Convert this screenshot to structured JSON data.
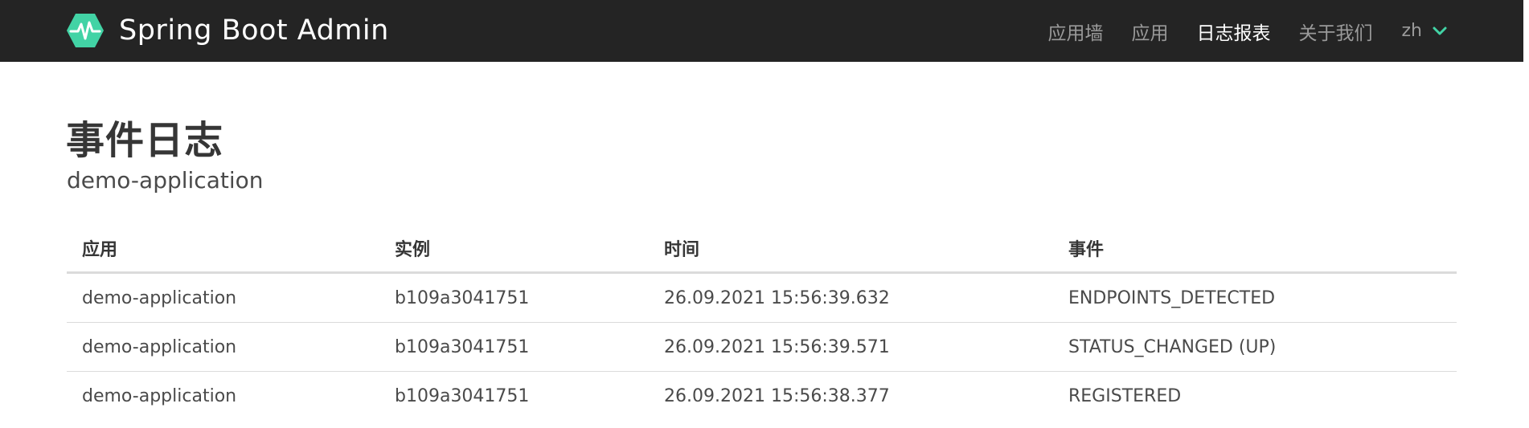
{
  "navbar": {
    "brand": {
      "logo_icon": "heartbeat-hexagon-icon",
      "title": "Spring Boot Admin"
    },
    "menu": [
      {
        "label": "应用墙",
        "active": false
      },
      {
        "label": "应用",
        "active": false
      },
      {
        "label": "日志报表",
        "active": true
      },
      {
        "label": "关于我们",
        "active": false
      }
    ],
    "language": {
      "value": "zh",
      "icon": "chevron-down-icon"
    }
  },
  "header": {
    "title": "事件日志",
    "subtitle": "demo-application"
  },
  "table": {
    "columns": [
      "应用",
      "实例",
      "时间",
      "事件"
    ],
    "rows": [
      [
        "demo-application",
        "b109a3041751",
        "26.09.2021 15:56:39.632",
        "ENDPOINTS_DETECTED"
      ],
      [
        "demo-application",
        "b109a3041751",
        "26.09.2021 15:56:39.571",
        "STATUS_CHANGED (UP)"
      ],
      [
        "demo-application",
        "b109a3041751",
        "26.09.2021 15:56:38.377",
        "REGISTERED"
      ]
    ]
  },
  "colors": {
    "navbar_bg": "#242424",
    "brand_accent": "#42d3a5",
    "nav_active": "#ffffff",
    "nav_inactive": "#9a9a9a",
    "text": "#363636"
  }
}
